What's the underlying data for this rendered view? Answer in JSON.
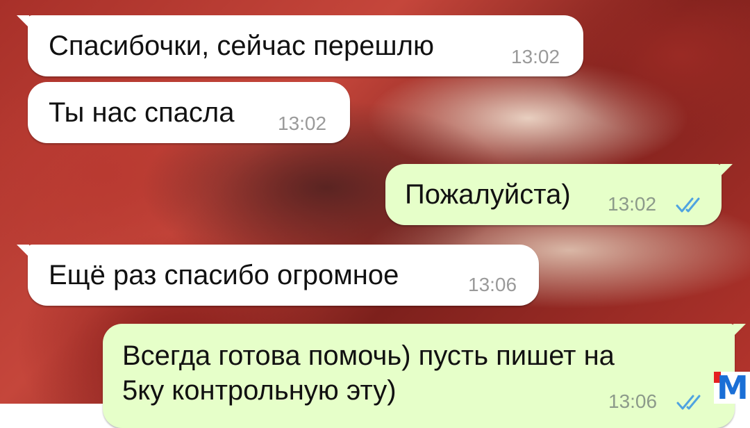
{
  "chat": {
    "messages": [
      {
        "direction": "incoming",
        "text": "Спасибочки, сейчас перешлю",
        "time": "13:02"
      },
      {
        "direction": "incoming",
        "text": "Ты нас спасла",
        "time": "13:02"
      },
      {
        "direction": "outgoing",
        "text": "Пожалуйста)",
        "time": "13:02",
        "status": "read"
      },
      {
        "direction": "incoming",
        "text": "Ещё раз спасибо огромное",
        "time": "13:06"
      },
      {
        "direction": "outgoing",
        "text_line1": "Всегда готова помочь) пусть пишет на",
        "text_line2": "5ку контрольную эту)",
        "time": "13:06",
        "status": "read"
      }
    ]
  },
  "colors": {
    "incoming_bubble": "#ffffff",
    "outgoing_bubble": "#e6ffc9",
    "read_ticks": "#4fa3e0",
    "watermark_blue": "#1a6fd6",
    "watermark_red": "#e52020"
  },
  "watermark": {
    "letter": "M"
  }
}
